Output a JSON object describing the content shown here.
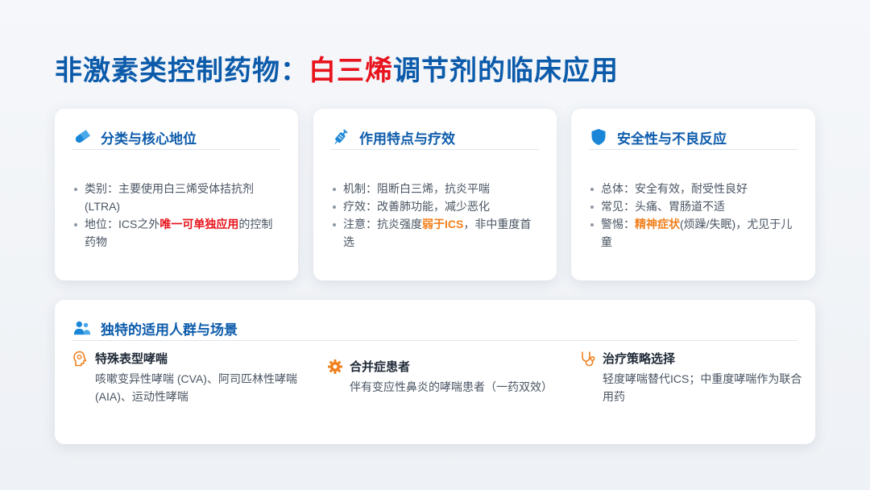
{
  "title": {
    "prefix": "非激素类控制药物：",
    "highlight": "白三烯",
    "suffix": "调节剂的临床应用"
  },
  "colors": {
    "primary": "#0c5bab",
    "red": "#e8131c",
    "orange": "#f0801e"
  },
  "cards": [
    {
      "heading": "分类与核心地位",
      "icon": "pill-icon",
      "bullets": [
        {
          "parts": [
            {
              "t": "类别：主要使用白三烯受体拮抗剂 (LTRA)"
            }
          ]
        },
        {
          "parts": [
            {
              "t": "地位：ICS之外"
            },
            {
              "t": "唯一可单独应用",
              "s": "red"
            },
            {
              "t": "的控制药物"
            }
          ]
        }
      ]
    },
    {
      "heading": "作用特点与疗效",
      "icon": "syringe-icon",
      "bullets": [
        {
          "parts": [
            {
              "t": "机制：阻断白三烯，抗炎平喘"
            }
          ]
        },
        {
          "parts": [
            {
              "t": "疗效：改善肺功能，减少恶化"
            }
          ]
        },
        {
          "parts": [
            {
              "t": "注意：抗炎强度"
            },
            {
              "t": "弱于ICS",
              "s": "orange"
            },
            {
              "t": "，非中重度首选"
            }
          ]
        }
      ]
    },
    {
      "heading": "安全性与不良反应",
      "icon": "shield-icon",
      "bullets": [
        {
          "parts": [
            {
              "t": "总体：安全有效，耐受性良好"
            }
          ]
        },
        {
          "parts": [
            {
              "t": "常见：头痛、胃肠道不适"
            }
          ]
        },
        {
          "parts": [
            {
              "t": "警惕："
            },
            {
              "t": "精神症状",
              "s": "orange"
            },
            {
              "t": "(烦躁/失眠)，尤见于儿童"
            }
          ]
        }
      ]
    }
  ],
  "scenarios": {
    "heading": "独特的适用人群与场景",
    "icon": "people-icon",
    "items": [
      {
        "title": "特殊表型哮喘",
        "desc": "咳嗽变异性哮喘 (CVA)、阿司匹林性哮喘 (AIA)、运动性哮喘",
        "icon": "head-brain-icon"
      },
      {
        "title": "合并症患者",
        "desc": "伴有变应性鼻炎的哮喘患者（一药双效）",
        "icon": "gear-icon"
      },
      {
        "title": "治疗策略选择",
        "desc": "轻度哮喘替代ICS；中重度哮喘作为联合用药",
        "icon": "stethoscope-icon"
      }
    ]
  }
}
